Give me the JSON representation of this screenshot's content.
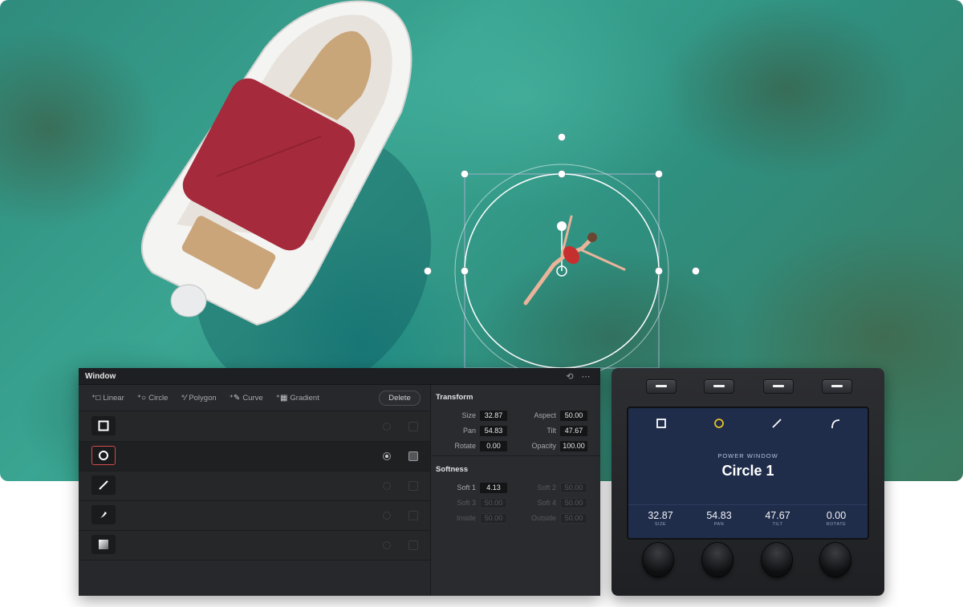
{
  "window_panel": {
    "title": "Window",
    "header_icons": [
      "reset-icon",
      "more-options-icon"
    ],
    "tools": [
      {
        "label": "Linear",
        "icon": "linear-window-icon"
      },
      {
        "label": "Circle",
        "icon": "circle-window-icon"
      },
      {
        "label": "Polygon",
        "icon": "polygon-window-icon"
      },
      {
        "label": "Curve",
        "icon": "curve-window-icon"
      },
      {
        "label": "Gradient",
        "icon": "gradient-window-icon"
      }
    ],
    "delete_label": "Delete",
    "rows": [
      {
        "shape": "square-shape-icon"
      },
      {
        "shape": "circle-shape-icon",
        "selected": true
      },
      {
        "shape": "line-shape-icon"
      },
      {
        "shape": "pen-shape-icon"
      },
      {
        "shape": "gradient-shape-icon"
      }
    ],
    "transform": {
      "title": "Transform",
      "size_label": "Size",
      "size": "32.87",
      "aspect_label": "Aspect",
      "aspect": "50.00",
      "pan_label": "Pan",
      "pan": "54.83",
      "tilt_label": "Tilt",
      "tilt": "47.67",
      "rotate_label": "Rotate",
      "rotate": "0.00",
      "opacity_label": "Opacity",
      "opacity": "100.00"
    },
    "softness": {
      "title": "Softness",
      "soft1_label": "Soft 1",
      "soft1": "4.13",
      "soft2_label": "Soft 2",
      "soft2": "50.00",
      "soft3_label": "Soft 3",
      "soft3": "50.00",
      "soft4_label": "Soft 4",
      "soft4": "50.00",
      "inside_label": "Inside",
      "inside": "50.00",
      "outside_label": "Outside",
      "outside": "50.00"
    }
  },
  "device": {
    "lcd": {
      "kicker": "POWER WINDOW",
      "title": "Circle 1",
      "accent_color": "#e6c229",
      "readouts": [
        {
          "value": "32.87",
          "caption": "SIZE"
        },
        {
          "value": "54.83",
          "caption": "PAN"
        },
        {
          "value": "47.67",
          "caption": "TILT"
        },
        {
          "value": "0.00",
          "caption": "ROTATE"
        }
      ]
    }
  }
}
